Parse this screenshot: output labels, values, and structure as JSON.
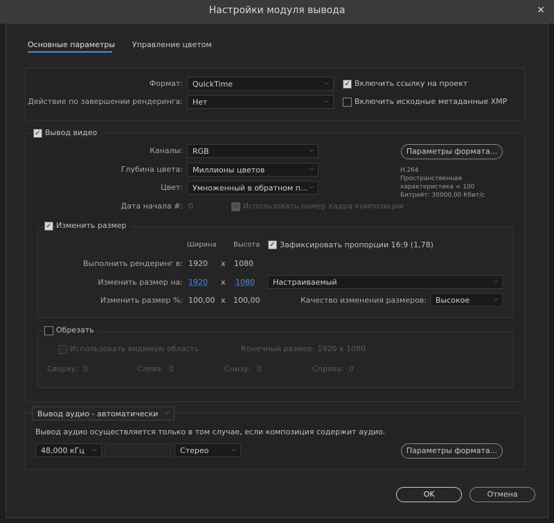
{
  "window": {
    "title": "Настройки модуля вывода",
    "close": "✕"
  },
  "tabs": [
    {
      "label": "Основные параметры",
      "active": true
    },
    {
      "label": "Управление цветом",
      "active": false
    }
  ],
  "general": {
    "format_label": "Формат:",
    "format_value": "QuickTime",
    "post_render_label": "Действие по завершении рендеринга:",
    "post_render_value": "Нет",
    "include_link_label": "Включить ссылку на проект",
    "include_link_checked": true,
    "include_xmp_label": "Включить исходные метаданные XMP",
    "include_xmp_checked": false
  },
  "video": {
    "section_label": "Вывод видео",
    "enabled": true,
    "channels_label": "Каналы:",
    "channels_value": "RGB",
    "depth_label": "Глубина цвета:",
    "depth_value": "Миллионы цветов",
    "color_label": "Цвет:",
    "color_value": "Умноженный в обратном п...",
    "start_label": "Дата начала #:",
    "start_value": "0",
    "use_comp_frame_label": "Использовать номер кадра композиции",
    "format_options_button": "Параметры формата...",
    "codec_info": [
      "H.264",
      "Пространственная",
      "характеристика = 100",
      "Битрейт: 30000,00 Кбит/с"
    ]
  },
  "resize": {
    "section_label": "Изменить размер",
    "enabled": true,
    "width_header": "Ширина",
    "height_header": "Высота",
    "lock_label": "Зафиксировать пропорции 16:9 (1,78)",
    "lock_checked": true,
    "rendering_at_label": "Выполнить рендеринг в:",
    "rendering_w": "1920",
    "rendering_h": "1080",
    "resize_to_label": "Изменить размер на:",
    "resize_w": "1920",
    "resize_h": "1080",
    "preset_value": "Настраиваемый",
    "resize_pct_label": "Изменить размер %:",
    "pct_w": "100,00",
    "pct_h": "100,00",
    "quality_label": "Качество изменения размеров:",
    "quality_value": "Высокое",
    "x": "x"
  },
  "crop": {
    "section_label": "Обрезать",
    "enabled": false,
    "use_roi_label": "Использовать видимую область",
    "final_size_label": "Конечный размер: 1920 x 1080",
    "top_label": "Сверху:",
    "top_value": "0",
    "left_label": "Слева:",
    "left_value": "0",
    "bottom_label": "Снизу:",
    "bottom_value": "0",
    "right_label": "Справа:",
    "right_value": "0"
  },
  "audio": {
    "mode_value": "Вывод аудио - автоматически",
    "info_text": "Вывод аудио осуществляется только в том случае, если композиция содержит аудио.",
    "rate_value": "48,000 кГц",
    "depth_value": "",
    "channels_value": "Стерео",
    "format_options_button": "Параметры формата..."
  },
  "footer": {
    "ok_label": "OK",
    "cancel_label": "Отмена"
  }
}
